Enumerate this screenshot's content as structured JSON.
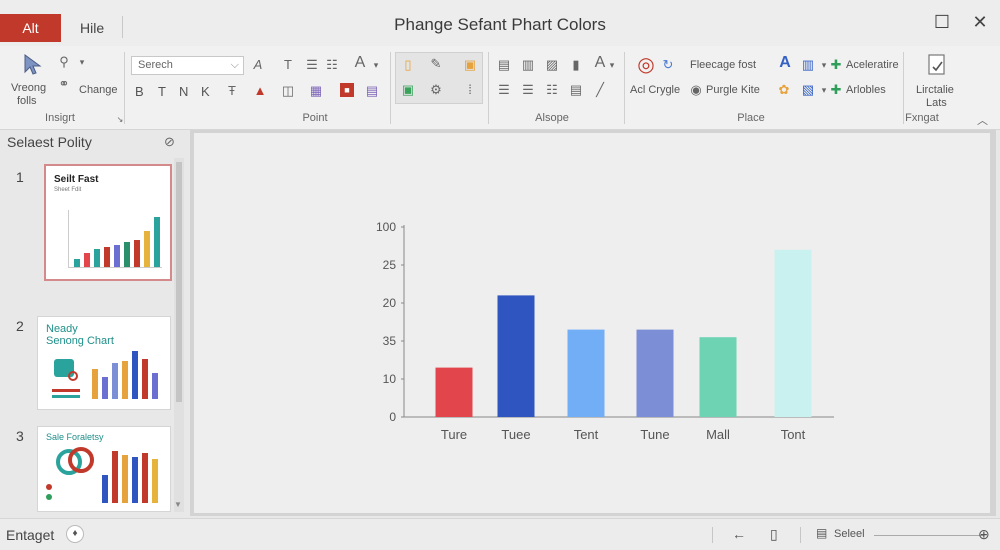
{
  "titlebar": {
    "file_label": "Alt",
    "tab_label": "Hile",
    "title": "Phange Sefant Phart Colors",
    "restore_glyph": "☐",
    "close_glyph": "✕"
  },
  "ribbon": {
    "insert_group": {
      "big_button_label_1": "Vreong",
      "big_button_label_2": "folls",
      "small_label": "Change",
      "group_label": "Insigrt"
    },
    "font_group": {
      "search_value": "Serech",
      "bold": "B",
      "italic": "T",
      "n": "N",
      "k": "K",
      "group_label": "Point"
    },
    "arrange_group": {
      "group_label": "Alsope"
    },
    "place_group": {
      "item_1": "Fleecage fost",
      "item_2": "Purgle Kite",
      "item_3": "Aceleratire",
      "item_4": "Arlobles",
      "left_label": "Acl Crygle",
      "group_label": "Place"
    },
    "format_group": {
      "label_1": "Lirctalie",
      "label_2": "Lats",
      "group_label": "Fxngat"
    }
  },
  "slide_pane": {
    "title": "Selaest Polity",
    "slides": [
      {
        "number": "1",
        "title": "Seilt Fast",
        "subtitle": "Sheet Fdit"
      },
      {
        "number": "2",
        "title": "Neady",
        "title2": "Senong Chart"
      },
      {
        "number": "3",
        "title": "Sale Foraletsy"
      }
    ]
  },
  "chart_data": {
    "type": "bar",
    "categories": [
      "Ture",
      "Tuee",
      "Tent",
      "Tune",
      "Mall",
      "Tont"
    ],
    "values": [
      13,
      32,
      23,
      23,
      21,
      44
    ],
    "ytick_labels": [
      "0",
      "10",
      "35",
      "20",
      "25",
      "100"
    ],
    "ylim": [
      0,
      50
    ],
    "colors": [
      "#e2454b",
      "#2f55c0",
      "#72aef5",
      "#7c8fd6",
      "#6dd3b2",
      "#c9f1ef"
    ],
    "title": "",
    "xlabel": "",
    "ylabel": ""
  },
  "statusbar": {
    "label": "Entaget",
    "zoom_label": "Seleel"
  }
}
